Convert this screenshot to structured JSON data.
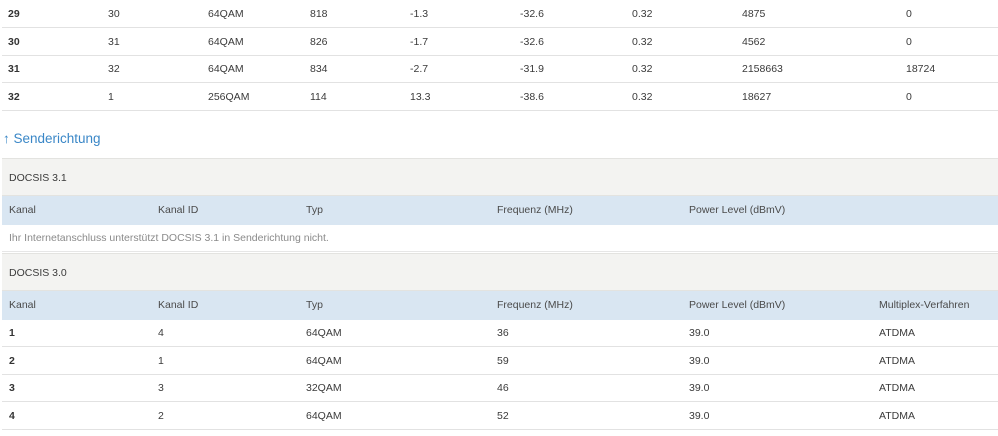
{
  "downstream_tail": {
    "rows": [
      [
        "29",
        "30",
        "64QAM",
        "818",
        "-1.3",
        "-32.6",
        "0.32",
        "4875",
        "0"
      ],
      [
        "30",
        "31",
        "64QAM",
        "826",
        "-1.7",
        "-32.6",
        "0.32",
        "4562",
        "0"
      ],
      [
        "31",
        "32",
        "64QAM",
        "834",
        "-2.7",
        "-31.9",
        "0.32",
        "2158663",
        "18724"
      ],
      [
        "32",
        "1",
        "256QAM",
        "114",
        "13.3",
        "-38.6",
        "0.32",
        "18627",
        "0"
      ]
    ]
  },
  "upstream": {
    "title": "↑ Senderichtung",
    "docsis31": {
      "label": "DOCSIS 3.1",
      "columns": [
        "Kanal",
        "Kanal ID",
        "Typ",
        "Frequenz (MHz)",
        "Power Level (dBmV)"
      ],
      "info": "Ihr Internetanschluss unterstützt DOCSIS 3.1 in Senderichtung nicht."
    },
    "docsis30": {
      "label": "DOCSIS 3.0",
      "columns": [
        "Kanal",
        "Kanal ID",
        "Typ",
        "Frequenz (MHz)",
        "Power Level (dBmV)",
        "Multiplex-Verfahren"
      ],
      "rows": [
        [
          "1",
          "4",
          "64QAM",
          "36",
          "39.0",
          "ATDMA"
        ],
        [
          "2",
          "1",
          "64QAM",
          "59",
          "39.0",
          "ATDMA"
        ],
        [
          "3",
          "3",
          "32QAM",
          "46",
          "39.0",
          "ATDMA"
        ],
        [
          "4",
          "2",
          "64QAM",
          "52",
          "39.0",
          "ATDMA"
        ]
      ]
    }
  },
  "colors": {
    "accent": "#3a87c7",
    "section_bg": "#f3f3f1",
    "column_header_bg": "#d9e6f2"
  }
}
